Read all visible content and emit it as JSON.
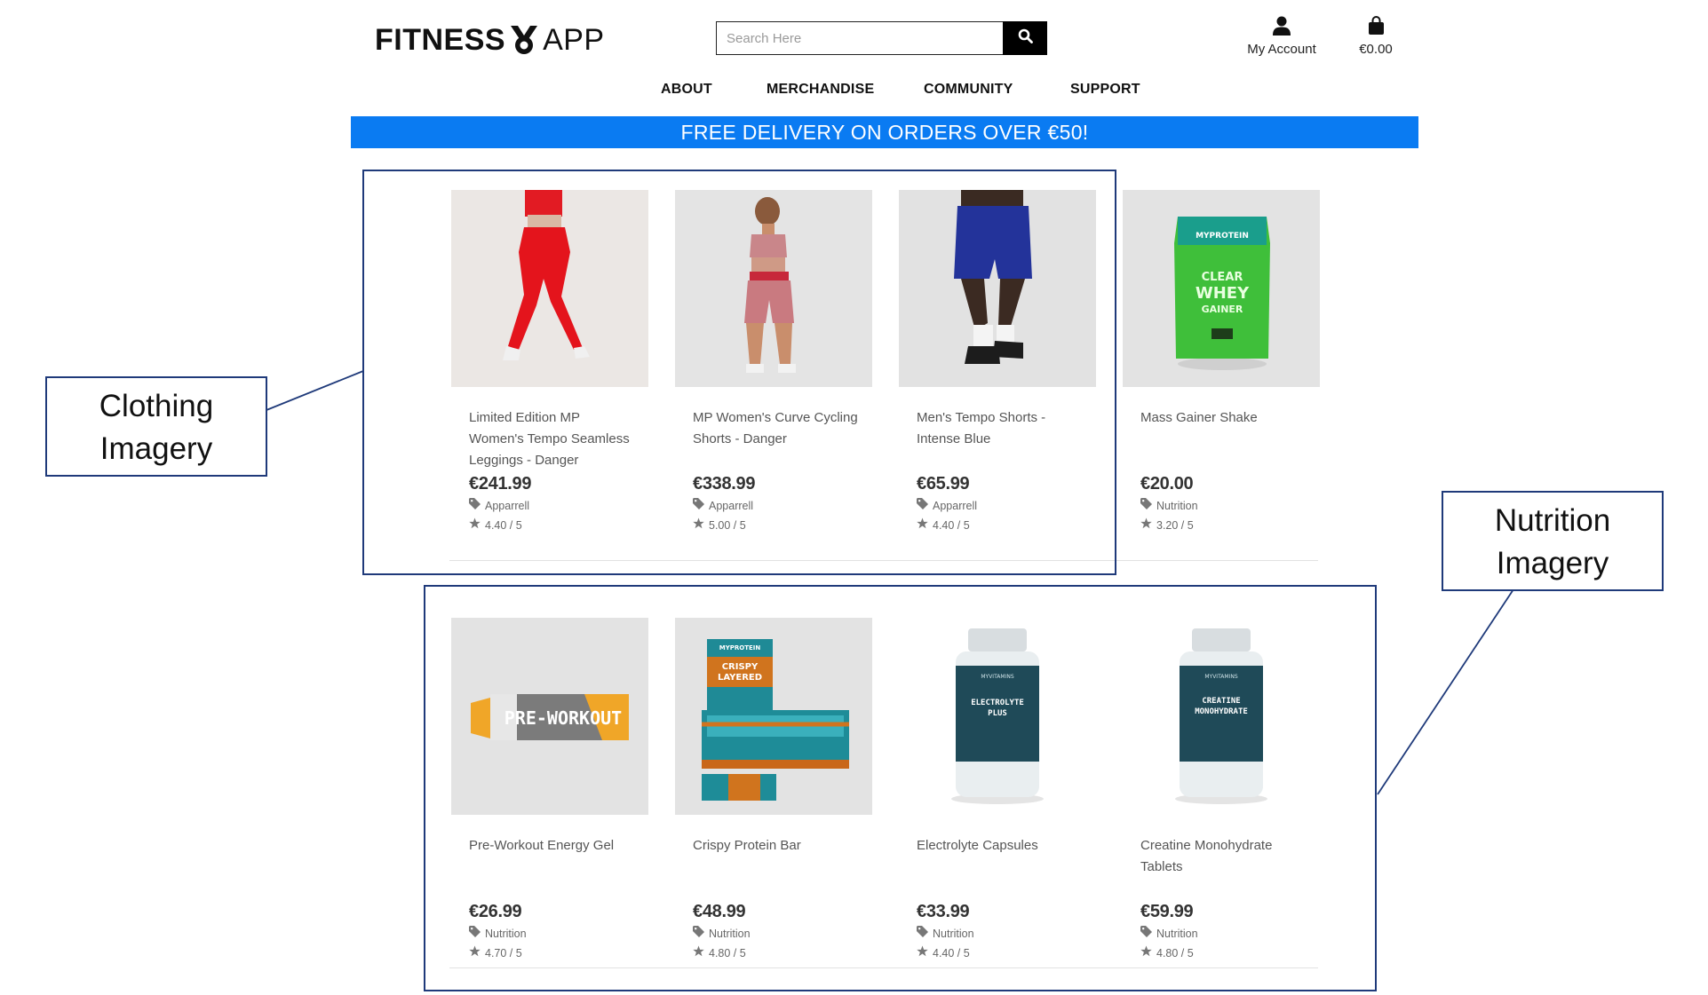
{
  "header": {
    "logo_word1": "FITNESS",
    "logo_word2": "APP",
    "search_placeholder": "Search Here",
    "search_icon": "magnifier-icon",
    "account_label": "My Account",
    "account_icon": "user-icon",
    "cart_total": "€0.00",
    "cart_icon": "shopping-bag-icon"
  },
  "nav": {
    "items": [
      "ABOUT",
      "MERCHANDISE",
      "COMMUNITY",
      "SUPPORT"
    ]
  },
  "promo": {
    "text": "FREE DELIVERY ON ORDERS OVER €50!",
    "color": "#0a7bf2"
  },
  "products": [
    {
      "name": "Limited Edition MP Women's Tempo Seamless Leggings - Danger",
      "price": "€241.99",
      "category": "Apparrell",
      "rating": "4.40 / 5"
    },
    {
      "name": "MP Women's Curve Cycling Shorts - Danger",
      "price": "€338.99",
      "category": "Apparrell",
      "rating": "5.00 / 5"
    },
    {
      "name": "Men's Tempo Shorts - Intense Blue",
      "price": "€65.99",
      "category": "Apparrell",
      "rating": "4.40 / 5"
    },
    {
      "name": "Mass Gainer Shake",
      "price": "€20.00",
      "category": "Nutrition",
      "rating": "3.20 / 5"
    },
    {
      "name": "Pre-Workout Energy Gel",
      "price": "€26.99",
      "category": "Nutrition",
      "rating": "4.70 / 5"
    },
    {
      "name": "Crispy Protein Bar",
      "price": "€48.99",
      "category": "Nutrition",
      "rating": "4.80 / 5"
    },
    {
      "name": "Electrolyte Capsules",
      "price": "€33.99",
      "category": "Nutrition",
      "rating": "4.40 / 5"
    },
    {
      "name": "Creatine Monohydrate Tablets",
      "price": "€59.99",
      "category": "Nutrition",
      "rating": "4.80 / 5"
    }
  ],
  "product_image_text": {
    "mass_gainer_brand": "MYPROTEIN",
    "mass_gainer_line1": "CLEAR",
    "mass_gainer_line2": "WHEY",
    "mass_gainer_line3": "GAINER",
    "preworkout_label": "PRE-WORKOUT",
    "bar_brand": "MYPROTEIN",
    "bar_label1": "CRISPY",
    "bar_label2": "LAYERED",
    "electrolyte_brand": "MYVITAMINS",
    "electrolyte_label1": "ELECTROLYTE",
    "electrolyte_label2": "PLUS",
    "creatine_brand": "MYVITAMINS",
    "creatine_label1": "CREATINE",
    "creatine_label2": "MONOHYDRATE"
  },
  "annotations": {
    "clothing_line1": "Clothing",
    "clothing_line2": "Imagery",
    "nutrition_line1": "Nutrition",
    "nutrition_line2": "Imagery",
    "color": "#1f3a7a"
  }
}
